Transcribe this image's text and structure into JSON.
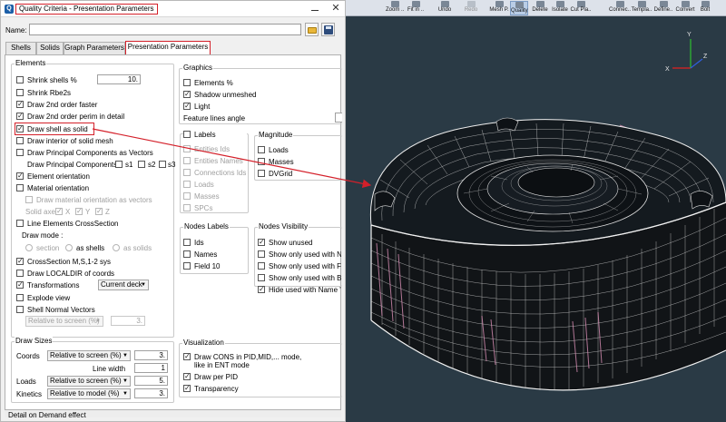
{
  "dialog": {
    "title": "Quality Criteria - Presentation Parameters",
    "close_label": "✕",
    "name_label": "Name:",
    "name_value": "",
    "tabs": [
      {
        "label": "Shells"
      },
      {
        "label": "Solids"
      },
      {
        "label": "Graph Parameters"
      },
      {
        "label": "Presentation Parameters",
        "active": true
      }
    ],
    "elements": {
      "title": "Elements",
      "shrink_shells_label": "Shrink shells %",
      "shrink_shells_value": "10.",
      "shrink_rbe2s_label": "Shrink Rbe2s",
      "draw_2nd_order_faster_label": "Draw 2nd order faster",
      "draw_2nd_order_perim_label": "Draw 2nd order perim in detail",
      "draw_shell_as_solid_label": "Draw shell as solid",
      "draw_interior_label": "Draw interior of solid mesh",
      "draw_principal_vectors_label": "Draw Principal Components as Vectors",
      "draw_principal_components_label": "Draw Principal Components",
      "s1": "s1",
      "s2": "s2",
      "s3": "s3",
      "element_orientation_label": "Element orientation",
      "material_orientation_label": "Material orientation",
      "draw_material_vectors_label": "Draw material orientation as vectors",
      "solid_axes_label": "Solid axes",
      "axis_x": "X",
      "axis_y": "Y",
      "axis_z": "Z",
      "line_elements_label": "Line Elements CrossSection",
      "draw_mode_label": "Draw mode :",
      "mode_section": "section",
      "mode_shells": "as shells",
      "mode_solids": "as solids",
      "crosssection_label": "CrossSection M,S,1-2 sys",
      "draw_localdir_label": "Draw LOCALDIR of coords",
      "transformations_label": "Transformations",
      "transformations_option": "Current deck",
      "explode_view_label": "Explode view",
      "shell_normal_label": "Shell Normal Vectors",
      "shell_normal_option": "Relative to screen (%)",
      "shell_normal_value": "3."
    },
    "draw_sizes": {
      "title": "Draw Sizes",
      "coords_label": "Coords",
      "coords_option": "Relative to screen (%)",
      "coords_value": "3.",
      "line_width_label": "Line width",
      "line_width_value": "1",
      "loads_label": "Loads",
      "loads_option": "Relative to screen (%)",
      "loads_value": "5.",
      "kinetics_label": "Kinetics",
      "kinetics_option": "Relative to model (%)",
      "kinetics_value": "3."
    },
    "graphics": {
      "title": "Graphics",
      "elements_pct_label": "Elements %",
      "shadow_label": "Shadow unmeshed",
      "light_label": "Light",
      "feature_angle_label": "Feature lines angle"
    },
    "labels": {
      "title": "Labels",
      "items": [
        "Entities Ids",
        "Entities Names",
        "Connections Ids",
        "Loads",
        "Masses",
        "SPCs"
      ]
    },
    "magnitude": {
      "title": "Magnitude",
      "items": [
        "Loads",
        "Masses",
        "DVGrid"
      ]
    },
    "nodes_labels": {
      "title": "Nodes Labels",
      "items": [
        "Ids",
        "Names",
        "Field 10"
      ]
    },
    "nodes_visibility": {
      "title": "Nodes Visibility",
      "items": [
        "Show unused",
        "Show only used with Nam",
        "Show only used with Fiel",
        "Show only used with Bolt",
        "Hide used with Name \"Sa"
      ]
    },
    "visualization": {
      "title": "Visualization",
      "draw_cons_line1": "Draw CONS in PID,MID,... mode,",
      "draw_cons_line2": "like in ENT mode",
      "draw_per_pid_label": "Draw per PID",
      "transparency_label": "Transparency"
    },
    "detail_label": "Detail on Demand effect"
  },
  "toolbar": {
    "buttons": [
      {
        "label": "Zoom .."
      },
      {
        "label": "Fit in .."
      },
      {
        "label": "Undo"
      },
      {
        "label": "Redo"
      },
      {
        "label": "Mesh P."
      },
      {
        "label": "Quality"
      },
      {
        "label": "Delete"
      },
      {
        "label": "Isolate"
      },
      {
        "label": "Cut Pla.."
      },
      {
        "label": "Connec.."
      },
      {
        "label": "Templa.."
      },
      {
        "label": "Define.."
      },
      {
        "label": "Convert"
      },
      {
        "label": "Bolt"
      }
    ]
  },
  "axes": {
    "x": "X",
    "y": "Y",
    "z": "Z"
  },
  "colors": {
    "highlight": "#d4202a",
    "viewport_bg": "#2a3a45",
    "mesh_line": "#ffffff",
    "mesh_accent": "#d98fb5",
    "axis_x": "#e02020",
    "axis_y": "#2fbf2f",
    "axis_z": "#2f5fe0"
  }
}
